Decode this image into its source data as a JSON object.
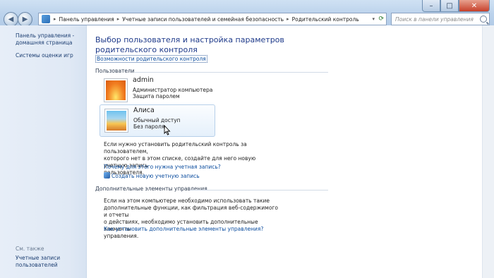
{
  "window": {
    "controls": {
      "minimize": "–",
      "maximize": "□",
      "close": "✕"
    }
  },
  "nav": {
    "back_icon": "◀",
    "forward_icon": "▶",
    "dropdown_icon": "▾"
  },
  "breadcrumbs": [
    "Панель управления",
    "Учетные записи пользователей и семейная безопасность",
    "Родительский контроль"
  ],
  "address": {
    "dropdown_icon": "▾",
    "refresh_icon": "⟳"
  },
  "search": {
    "placeholder": "Поиск в панели управления"
  },
  "sidebar": {
    "links": [
      "Панель управления -",
      "домашняя страница",
      "Системы оценки игр"
    ],
    "see_also_heading": "См. также",
    "see_also_links": [
      "Учетные записи",
      "пользователей"
    ]
  },
  "main": {
    "title_line1": "Выбор пользователя и настройка параметров",
    "title_line2": "родительского контроля",
    "subtitle_link": "Возможности родительского контроля",
    "users_heading": "Пользователи",
    "users": [
      {
        "name": "admin",
        "line1": "Администратор компьютера",
        "line2": "Защита паролем"
      },
      {
        "name": "Алиса",
        "line1": "Обычный доступ",
        "line2": "Без пароля"
      }
    ],
    "info1_lines": [
      "Если нужно установить родительский контроль за пользователем,",
      "которого нет в этом списке, создайте для него новую учетную запись",
      "пользователя."
    ],
    "why_link": "Почему для этого нужна учетная запись?",
    "create_link": "Создать новую учетную запись",
    "extra_heading": "Дополнительные элементы управления",
    "info2_lines": [
      "Если на этом компьютере необходимо использовать такие",
      "дополнительные функции, как фильтрация веб-содержимого и отчеты",
      "о действиях, необходимо установить дополнительные элементы",
      "управления."
    ],
    "install_link": "Как установить дополнительные элементы управления?"
  }
}
